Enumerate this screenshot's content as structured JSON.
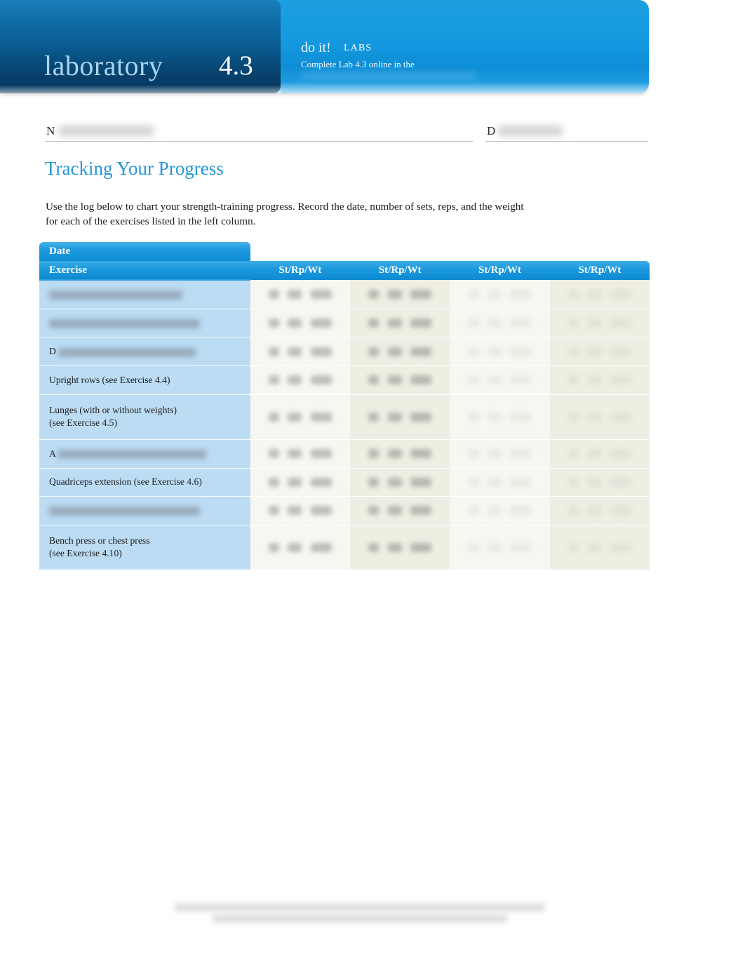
{
  "header": {
    "lab_word": "laboratory",
    "lab_number": "4.3",
    "doit_label": "do it!",
    "labs_label": "LABS",
    "doit_subtitle": "Complete Lab 4.3 online in the",
    "colors": {
      "dark_panel": "#07426e",
      "light_panel": "#159ae0",
      "lab_word_color": "#a9d4ef"
    }
  },
  "fields": {
    "name_letter": "N",
    "date_letter": "D"
  },
  "content": {
    "title": "Tracking Your Progress",
    "intro": "Use the log below to chart your strength-training progress. Record the date, number of sets, reps, and the weight for each of the exercises listed in the left column.",
    "title_color": "#2397d4"
  },
  "table": {
    "header": {
      "date_label": "Date",
      "exercise_label": "Exercise",
      "data_columns": [
        "St/Rp/Wt",
        "St/Rp/Wt",
        "St/Rp/Wt",
        "St/Rp/Wt"
      ]
    },
    "rows": [
      {
        "label": "",
        "prefix": "",
        "redacted": true
      },
      {
        "label": "",
        "prefix": "",
        "redacted": true
      },
      {
        "label": "",
        "prefix": "D",
        "redacted": true
      },
      {
        "label": "Upright rows (see Exercise 4.4)",
        "prefix": "",
        "redacted": false
      },
      {
        "label": "Lunges (with or without weights)\n(see Exercise 4.5)",
        "prefix": "",
        "redacted": false
      },
      {
        "label": "",
        "prefix": "A",
        "redacted": true
      },
      {
        "label": "Quadriceps extension (see Exercise 4.6)",
        "prefix": "",
        "redacted": false
      },
      {
        "label": "",
        "prefix": "",
        "redacted": true
      },
      {
        "label": "Bench press or chest press\n(see Exercise 4.10)",
        "prefix": "",
        "redacted": false
      }
    ],
    "colors": {
      "header_band": "#1c98dd",
      "exercise_column": "#bcdcf4",
      "data_tint_light": "#f7f7f1",
      "data_tint_dark": "#eeeee3"
    }
  }
}
